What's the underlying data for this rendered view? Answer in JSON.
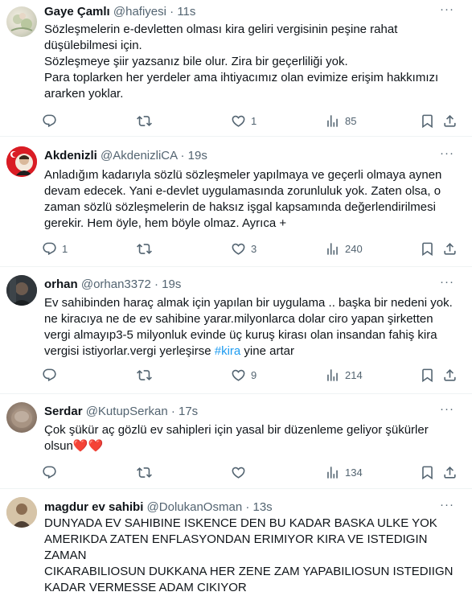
{
  "tweets": [
    {
      "name": "Gaye Çamlı",
      "handle": "@hafiyesi",
      "time": "11s",
      "lines": [
        "Sözleşmelerin e-devletten olması kira geliri vergisinin peşine rahat",
        "düşülebilmesi için.",
        "Sözleşmeye şiir yazsanız bile olur. Zira bir geçerliliği yok.",
        "Para toplarken her yerdeler ama ihtiyacımız olan evimize erişim hakkımızı",
        "ararken yoklar."
      ],
      "replies": "",
      "retweets": "",
      "likes": "1",
      "views": "85"
    },
    {
      "name": "Akdenizli",
      "handle": "@AkdenizliCA",
      "time": "19s",
      "lines": [
        "Anladığım kadarıyla sözlü sözleşmeler yapılmaya ve geçerli olmaya aynen",
        "devam edecek. Yani e-devlet uygulamasında zorunluluk yok. Zaten olsa, o",
        "zaman sözlü sözleşmelerin de haksız işgal kapsamında değerlendirilmesi",
        "gerekir. Hem öyle, hem böyle olmaz. Ayrıca +"
      ],
      "replies": "1",
      "retweets": "",
      "likes": "3",
      "views": "240"
    },
    {
      "name": "orhan",
      "handle": "@orhan3372",
      "time": "19s",
      "lines": [
        "Ev sahibinden haraç almak için yapılan bir uygulama .. başka bir nedeni yok.",
        "ne kiracıya ne de ev sahibine yarar.milyonlarca dolar ciro yapan şirketten",
        "vergi almayıp3-5 milyonluk evinde üç kuruş kirası olan insandan fahiş kira"
      ],
      "last_line_prefix": "vergisi istiyorlar.vergi yerleşirse ",
      "hashtag": "#kira",
      "last_line_suffix": " yine artar",
      "replies": "",
      "retweets": "",
      "likes": "9",
      "views": "214"
    },
    {
      "name": "Serdar",
      "handle": "@KutupSerkan",
      "time": "17s",
      "lines": [
        "Çok şükür aç gözlü ev sahipleri için yasal bir düzenleme geliyor şükürler"
      ],
      "last_line_prefix": "olsun",
      "emoji": "❤️❤️",
      "replies": "",
      "retweets": "",
      "likes": "",
      "views": "134"
    },
    {
      "name": "magdur ev sahibi",
      "handle": "@DolukanOsman",
      "time": "13s",
      "lines": [
        "DUNYADA EV SAHIBINE ISKENCE DEN BU KADAR BASKA ULKE YOK",
        "AMERIKDA ZATEN ENFLASYONDAN ERIMIYOR KIRA VE ISTEDIGIN ZAMAN",
        "CIKARABILIOSUN DUKKANA HER ZENE ZAM YAPABILIOSUN ISTEDIIGN",
        "KADAR VERMESSE ADAM CIKIYOR"
      ]
    }
  ],
  "separator": "·",
  "more_label": "···"
}
